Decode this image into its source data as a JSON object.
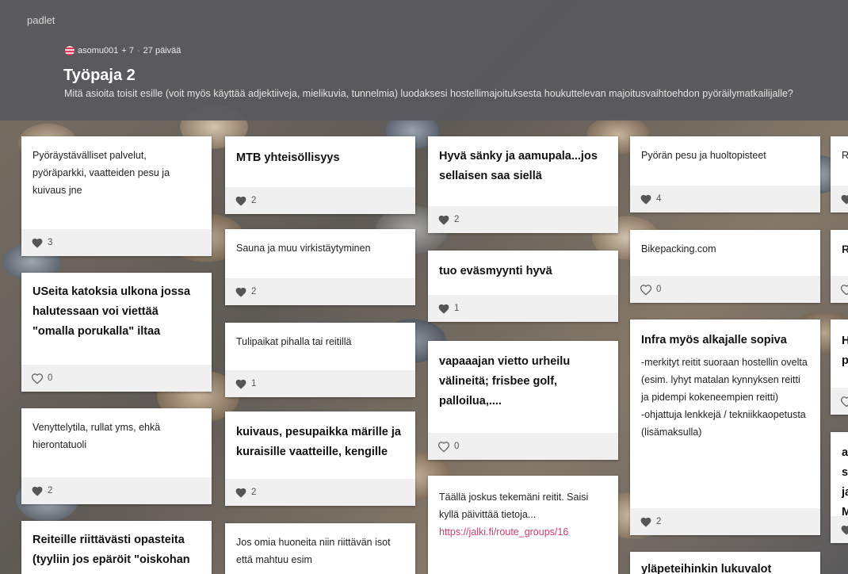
{
  "app": {
    "brand": "padlet"
  },
  "header": {
    "author": "asomu001",
    "contributors": "+ 7",
    "separator": "·",
    "age": "27 päivää",
    "title": "Työpaja 2",
    "subtitle": "Mitä asioita toisit esille (voit myös käyttää adjektiiveja, mielikuvia, tunnelmia) luodaksesi hostellimajoituksesta houkuttelevan majoitusvaihtoehdon pyöräilymatkailijalle?"
  },
  "posts": [
    {
      "text": "Pyöräystävälliset palvelut, pyöräparkki, vaatteiden pesu ja kuivaus jne",
      "likes": "3",
      "liked": true
    },
    {
      "text": "USeita katoksia ulkona jossa halutessaan voi viettää \"omalla porukalla\" iltaa",
      "likes": "0",
      "liked": false
    },
    {
      "text": "Venyttelytila, rullat  yms, ehkä hierontatuoli",
      "likes": "2",
      "liked": true
    },
    {
      "text": "Reiteille riittävästi opasteita (tyyliin jos epäröit \"oiskohan jo",
      "likes": "",
      "liked": false
    },
    {
      "text": "MTB yhteisöllisyys",
      "likes": "2",
      "liked": true
    },
    {
      "text": "Sauna ja muu virkistäytyminen",
      "likes": "2",
      "liked": true
    },
    {
      "text": "Tulipaikat pihalla tai reitillä",
      "likes": "1",
      "liked": true
    },
    {
      "text": "kuivaus, pesupaikka märille ja kuraisille vaatteille, kengille",
      "likes": "2",
      "liked": true
    },
    {
      "text": "Jos omia huoneita niin riittävän isot että mahtuu esim",
      "likes": "",
      "liked": false
    },
    {
      "text": "Hyvä sänky ja aamupala...jos sellaisen saa siellä",
      "likes": "2",
      "liked": true
    },
    {
      "text": "tuo eväsmyynti hyvä",
      "likes": "1",
      "liked": true
    },
    {
      "text": "vapaaajan vietto urheilu välineitä; frisbee golf, palloilua,....",
      "likes": "0",
      "liked": false
    },
    {
      "text": "Täällä joskus tekemäni reitit. Saisi kyllä päivittää tietoja...",
      "link": "https://jalki.fi/route_groups/16",
      "likes": "",
      "liked": false
    },
    {
      "text": "Pyörän pesu ja huoltopisteet",
      "likes": "4",
      "liked": true
    },
    {
      "text": "Bikepacking.com",
      "likes": "0",
      "liked": false
    },
    {
      "title": "Infra myös alkajalle sopiva",
      "text": "-merkityt reitit suoraan hostellin ovelta (esim. lyhyt matalan kynnyksen reitti ja pidempi kokeneempien reitti)",
      "text2": "-ohjattuja lenkkejä / tekniikkaopetusta (lisämaksulla)",
      "likes": "2",
      "liked": true
    },
    {
      "text": "yläpeteihinkin lukuvalot",
      "likes": "",
      "liked": false
    },
    {
      "text": "R",
      "likes": "",
      "liked": true
    },
    {
      "text": "R",
      "likes": "",
      "liked": false
    },
    {
      "text": "H p",
      "likes": "",
      "liked": false
    },
    {
      "text": "a s ja M",
      "likes": "",
      "liked": true
    }
  ],
  "colors": {
    "header_bg": "#58585c",
    "link": "#d23b6c",
    "heart_filled": "#555555"
  }
}
